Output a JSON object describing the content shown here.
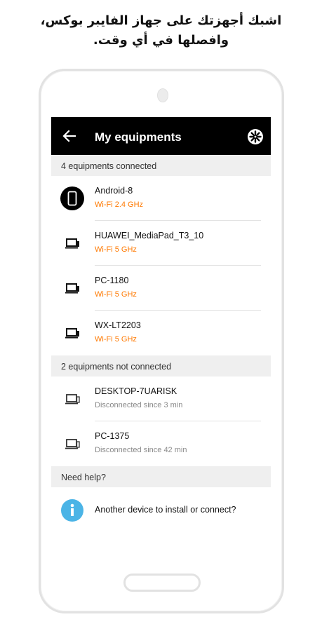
{
  "caption": {
    "line1": "اشبك أجهزتك على جهاز الفايبر بوكس،",
    "line2": "وافصلها في أي وقت."
  },
  "appbar": {
    "title": "My equipments",
    "back_icon": "arrow-left-icon",
    "settings_icon": "gear-icon"
  },
  "connected": {
    "header": "4 equipments connected",
    "items": [
      {
        "name": "Android-8",
        "status": "Wi-Fi 2.4 GHz",
        "icon": "smartphone-icon"
      },
      {
        "name": "HUAWEI_MediaPad_T3_10",
        "status": "Wi-Fi 5 GHz",
        "icon": "computer-icon"
      },
      {
        "name": "PC-1180",
        "status": "Wi-Fi 5 GHz",
        "icon": "computer-icon"
      },
      {
        "name": "WX-LT2203",
        "status": "Wi-Fi 5 GHz",
        "icon": "computer-icon"
      }
    ]
  },
  "disconnected": {
    "header": "2 equipments not connected",
    "items": [
      {
        "name": "DESKTOP-7UARISK",
        "status": "Disconnected since 3 min",
        "icon": "computer-icon"
      },
      {
        "name": "PC-1375",
        "status": "Disconnected since 42 min",
        "icon": "computer-icon"
      }
    ]
  },
  "help": {
    "header": "Need help?",
    "item": "Another device to install or connect?",
    "icon": "info-icon"
  },
  "colors": {
    "appbar_bg": "#000000",
    "connected_status": "#ff7900",
    "disconnected_status": "#8a8a8a",
    "section_bg": "#efefef",
    "info_blue": "#4bb4e6"
  }
}
